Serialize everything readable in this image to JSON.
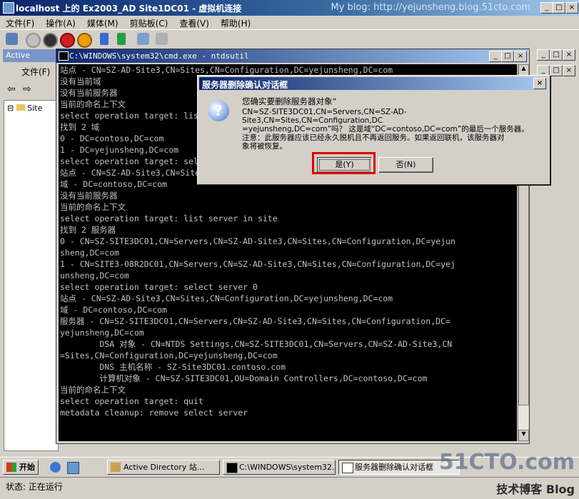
{
  "vm": {
    "title": "localhost 上的 Ex2003_AD Site1DC01 - 虚拟机连接",
    "blog": "My blog: http://yejunsheng.blog.51cto.com",
    "menu": [
      "文件(F)",
      "操作(A)",
      "媒体(M)",
      "剪贴板(C)",
      "查看(V)",
      "帮助(H)"
    ]
  },
  "ad_window": {
    "title": "Active",
    "menu_file": "文件(F)",
    "tree_root": "Site"
  },
  "cmd": {
    "title": "C:\\WINDOWS\\system32\\cmd.exe - ntdsutil",
    "lines": [
      "站点 - CN=SZ-AD-Site3,CN=Sites,CN=Configuration,DC=yejunsheng,DC=com",
      "没有当前域",
      "没有当前服务器",
      "当前的命名上下文",
      "select operation target: list domains",
      "找到 2 域",
      "0 - DC=contoso,DC=com",
      "1 - DC=yejunsheng,DC=com",
      "select operation target: select domain 0",
      "站点 - CN=SZ-AD-Site3,CN=Sites,CN=Configuration,DC=yejunsheng,DC=com",
      "域 - DC=contoso,DC=com",
      "没有当前服务器",
      "当前的命名上下文",
      "select operation target: list server in site",
      "找到 2 服务器",
      "0 - CN=SZ-SITE3DC01,CN=Servers,CN=SZ-AD-Site3,CN=Sites,CN=Configuration,DC=yejun",
      "sheng,DC=com",
      "1 - CN=SITE3-08R2DC01,CN=Servers,CN=SZ-AD-Site3,CN=Sites,CN=Configuration,DC=yej",
      "unsheng,DC=com",
      "select operation target: select server 0",
      "站点 - CN=SZ-AD-Site3,CN=Sites,CN=Configuration,DC=yejunsheng,DC=com",
      "域 - DC=contoso,DC=com",
      "服务器 - CN=SZ-SITE3DC01,CN=Servers,CN=SZ-AD-Site3,CN=Sites,CN=Configuration,DC=",
      "yejunsheng,DC=com",
      "        DSA 对象 - CN=NTDS Settings,CN=SZ-SITE3DC01,CN=Servers,CN=SZ-AD-Site3,CN",
      "=Sites,CN=Configuration,DC=yejunsheng,DC=com",
      "        DNS 主机名称 - SZ-Site3DC01.contoso.com",
      "        计算机对象 - CN=SZ-SITE3DC01,OU=Domain Controllers,DC=contoso,DC=com",
      "当前的命名上下文",
      "select operation target: quit",
      "metadata cleanup: remove select server"
    ]
  },
  "dialog": {
    "title": "服务器删除确认对话框",
    "message_1": "您确实要删除服务器对象“",
    "message_2": "CN=SZ-SITE3DC01,CN=Servers,CN=SZ-AD-Site3,CN=Sites,CN=Configuration,DC",
    "message_3": "=yejunsheng,DC=com”吗？ 这是域“DC=contoso,DC=com”的最后一个服务器。",
    "message_4": "注意：此服务器应该已经永久脱机且不再返回服务。如果返回联机，该服务器对",
    "message_5": "象将被恢复。",
    "yes_label": "是(Y)",
    "no_label": "否(N)"
  },
  "taskbar": {
    "start": "开始",
    "tasks": [
      "Active Directory 站...",
      "C:\\WINDOWS\\system32...",
      "服务器删除确认对话框"
    ]
  },
  "status": {
    "label": "状态: 正在运行"
  },
  "watermark": {
    "site": "51CTO.com",
    "sub": "技术博客 Blog"
  }
}
